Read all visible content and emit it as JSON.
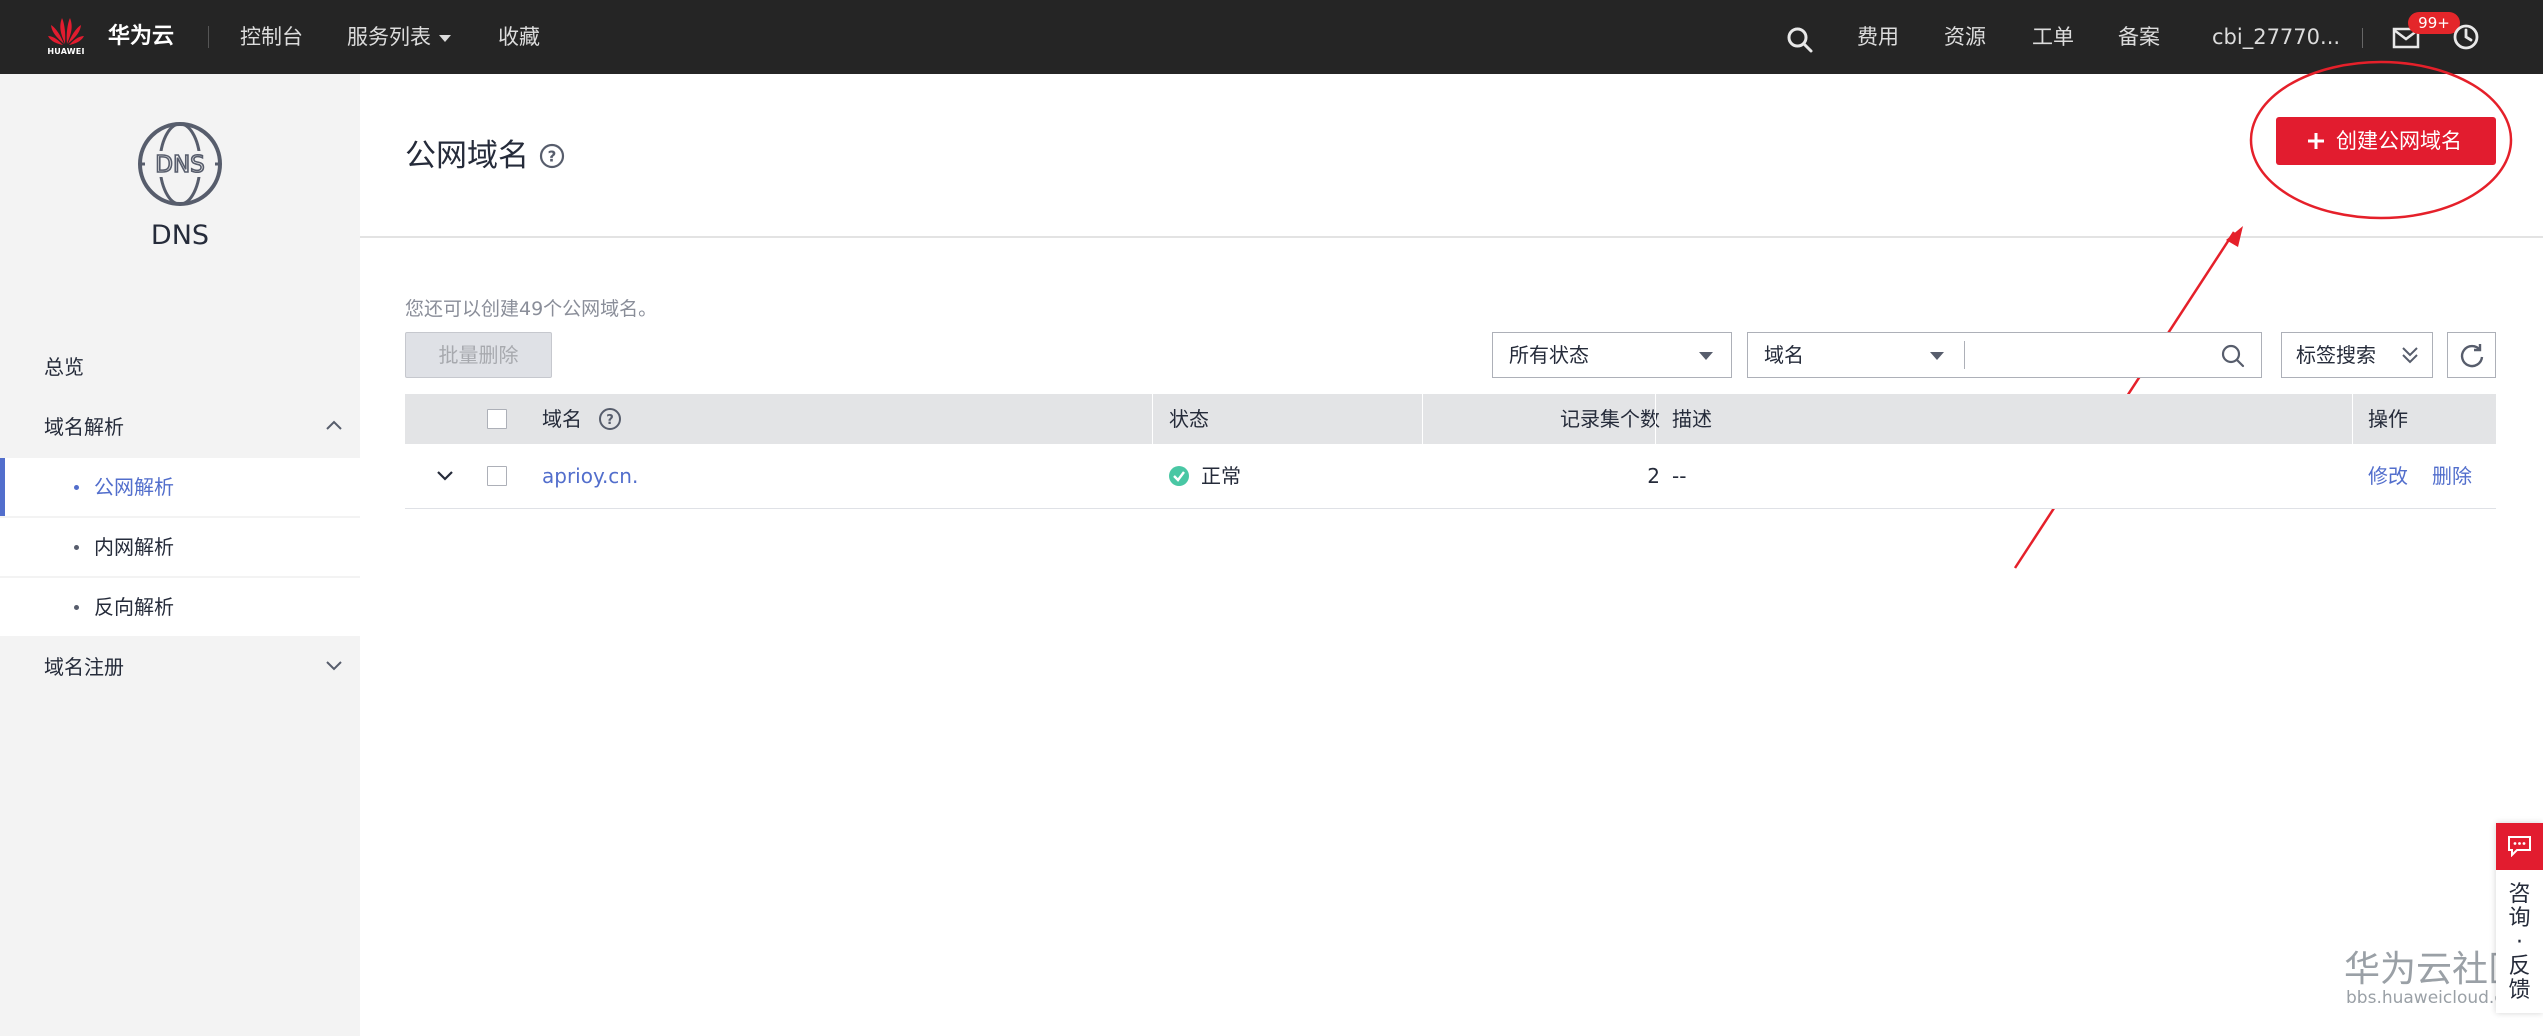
{
  "colors": {
    "topbar_bg": "#252525",
    "accent_blue": "#526ecc",
    "brand_red": "#e21c2f",
    "status_green": "#49c7a4",
    "annotation_red": "#e5202a"
  },
  "topbar": {
    "logo_text": "HUAWEI",
    "brand": "华为云",
    "nav": [
      "控制台",
      "服务列表",
      "收藏"
    ],
    "search_icon": "search-icon",
    "links": [
      "费用",
      "资源",
      "工单",
      "备案"
    ],
    "user": "cbi_27770...",
    "message_badge": "99+",
    "message_icon": "mail-icon",
    "clock_icon": "clock-icon"
  },
  "sidebar": {
    "service_icon": "dns-globe-icon",
    "service_name": "DNS",
    "items": [
      {
        "label": "总览"
      },
      {
        "label": "域名解析",
        "expanded": true,
        "children": [
          {
            "label": "公网解析",
            "active": true
          },
          {
            "label": "内网解析"
          },
          {
            "label": "反向解析"
          }
        ]
      },
      {
        "label": "域名注册",
        "expanded": false
      }
    ]
  },
  "main": {
    "title": "公网域名",
    "create_button": "创建公网域名",
    "quota_text": "您还可以创建49个公网域名。",
    "batch_delete": "批量删除",
    "status_filter": "所有状态",
    "search_field": "域名",
    "search_placeholder": "",
    "tag_search": "标签搜索",
    "table": {
      "headers": [
        "域名",
        "状态",
        "记录集个数",
        "描述",
        "操作"
      ],
      "rows": [
        {
          "domain": "aprioy.cn.",
          "status": "正常",
          "record_count": "2",
          "description": "--",
          "actions": [
            "修改",
            "删除"
          ]
        }
      ]
    }
  },
  "float_widget": {
    "label": "咨询·反馈",
    "chars": [
      "咨",
      "询",
      "·",
      "反",
      "馈"
    ]
  },
  "watermark": {
    "title": "华为云社区",
    "url": "bbs.huaweicloud.com"
  }
}
